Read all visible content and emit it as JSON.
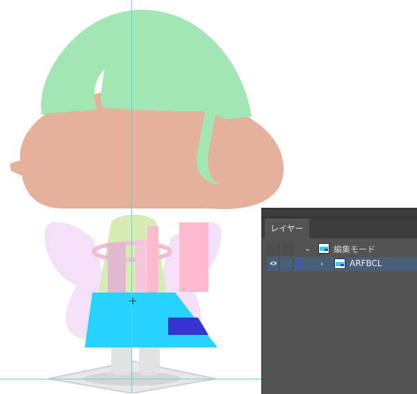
{
  "colors": {
    "hair_green": "#a1e6b3",
    "face_skin": "#e6b19a",
    "wing_pink": "#f4e0f8",
    "shirt": "#d6ecb4",
    "stripe": "#ffbad0",
    "selected_shape": "#28d2ff",
    "inner_rect": "#3434d0",
    "guide": "#4fd8e8",
    "panel_bg": "#535353",
    "selected_row": "#495f79"
  },
  "layers_panel": {
    "tab_label": "レイヤー",
    "rows": [
      {
        "name": "編集モード",
        "expanded": true,
        "visible": false
      },
      {
        "name": "ARFBCL",
        "expanded": false,
        "visible": true,
        "selected": true
      }
    ]
  }
}
